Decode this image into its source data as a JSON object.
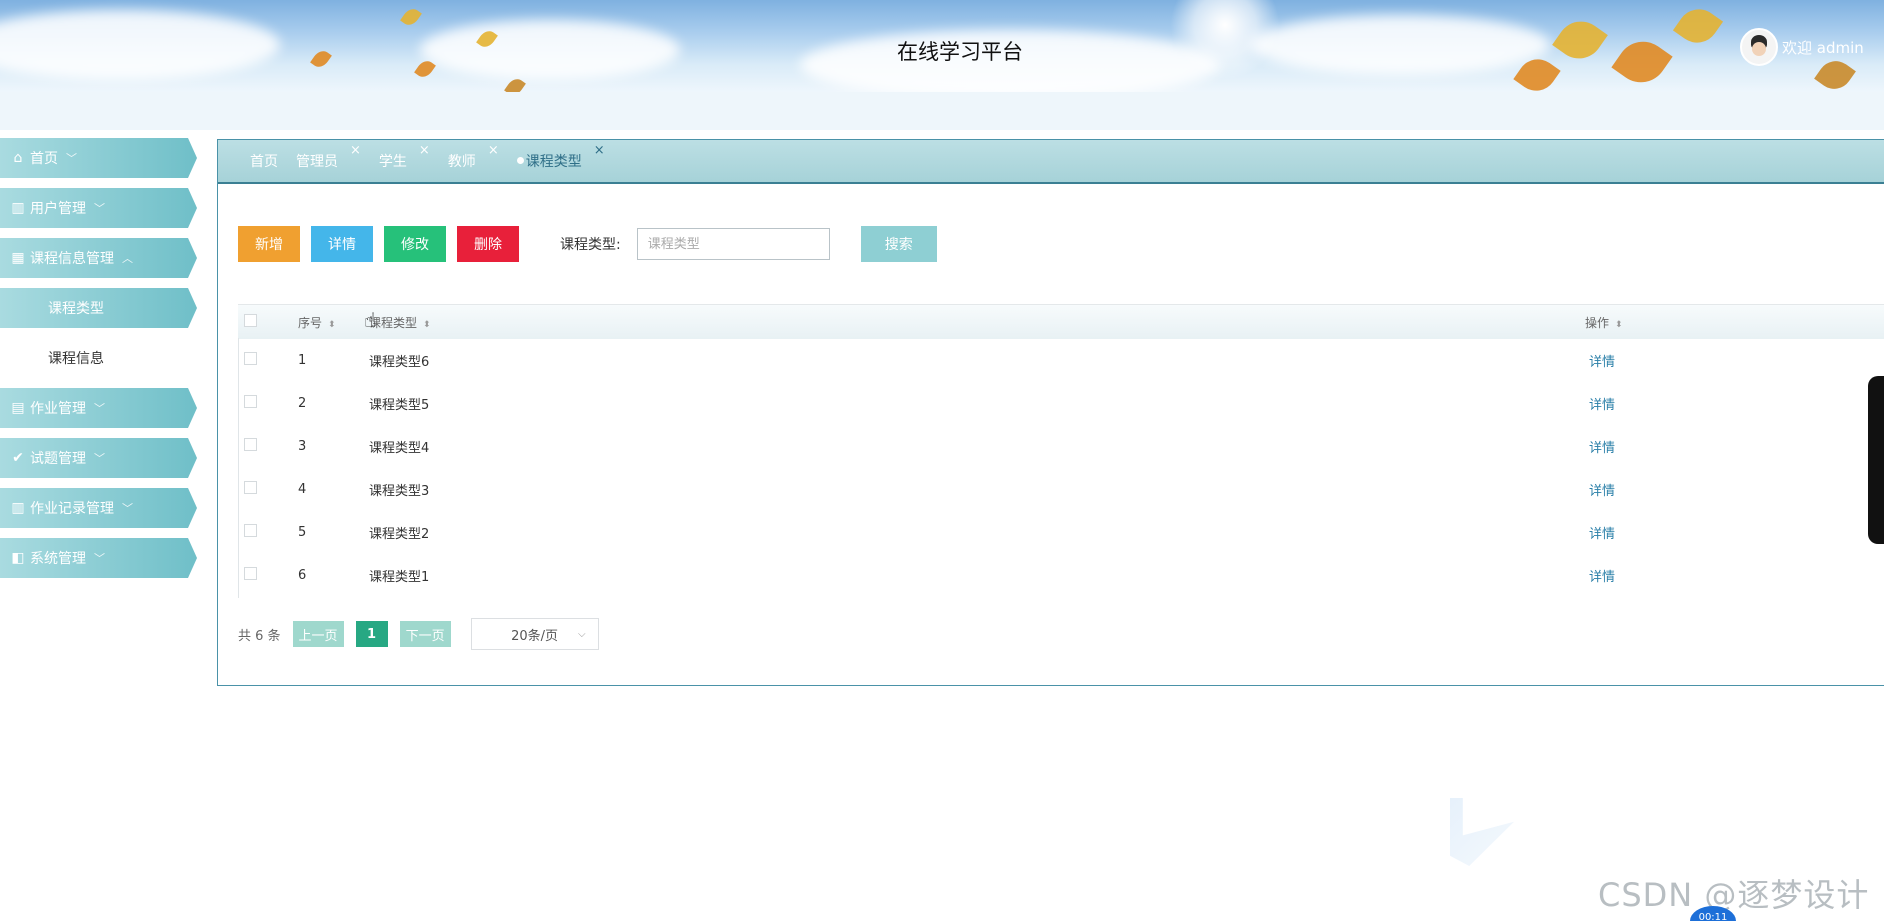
{
  "header": {
    "title": "在线学习平台",
    "welcome": "欢迎 admin"
  },
  "sidebar": {
    "items": [
      {
        "label": "首页",
        "icon": "home-icon",
        "glyph": "⌂",
        "chevron": "﹀"
      },
      {
        "label": "用户管理",
        "icon": "users-icon",
        "glyph": "▥",
        "chevron": "﹀"
      },
      {
        "label": "课程信息管理",
        "icon": "grid-icon",
        "glyph": "▦",
        "chevron": "︿",
        "children": [
          {
            "label": "课程类型",
            "active": true
          },
          {
            "label": "课程信息",
            "active": false
          }
        ]
      },
      {
        "label": "作业管理",
        "icon": "copy-icon",
        "glyph": "▤",
        "chevron": "﹀"
      },
      {
        "label": "试题管理",
        "icon": "check-circle-icon",
        "glyph": "✔",
        "chevron": "﹀"
      },
      {
        "label": "作业记录管理",
        "icon": "book-icon",
        "glyph": "▥",
        "chevron": "﹀"
      },
      {
        "label": "系统管理",
        "icon": "settings-box-icon",
        "glyph": "◧",
        "chevron": "﹀"
      }
    ]
  },
  "tabs": [
    {
      "label": "首页",
      "closable": false
    },
    {
      "label": "管理员",
      "closable": true
    },
    {
      "label": "学生",
      "closable": true
    },
    {
      "label": "教师",
      "closable": true
    },
    {
      "label": "课程类型",
      "closable": true,
      "active": true
    }
  ],
  "close_glyph": "×",
  "toolbar": {
    "add": "新增",
    "detail": "详情",
    "edit": "修改",
    "delete": "删除",
    "search_label": "课程类型:",
    "search_placeholder": "课程类型",
    "search_button": "搜索"
  },
  "table": {
    "columns": {
      "no": "序号",
      "type": "课程类型",
      "op": "操作"
    },
    "sort_glyph": "⬍",
    "rows": [
      {
        "no": "1",
        "type": "课程类型6",
        "op": "详情"
      },
      {
        "no": "2",
        "type": "课程类型5",
        "op": "详情"
      },
      {
        "no": "3",
        "type": "课程类型4",
        "op": "详情"
      },
      {
        "no": "4",
        "type": "课程类型3",
        "op": "详情"
      },
      {
        "no": "5",
        "type": "课程类型2",
        "op": "详情"
      },
      {
        "no": "6",
        "type": "课程类型1",
        "op": "详情"
      }
    ]
  },
  "pager": {
    "total": "共 6 条",
    "prev": "上一页",
    "current": "1",
    "next": "下一页",
    "page_size": "20条/页",
    "page_size_arrow": "⌵"
  },
  "overlay": {
    "watermark": "CSDN @逐梦设计",
    "timer": "00:11"
  },
  "colors": {
    "accent": "#6fbfc8",
    "add": "#f0a030",
    "detail": "#44b6ea",
    "edit": "#26c17a",
    "delete": "#e8203a",
    "search": "#8ecfd3",
    "pager_current": "#27a883"
  }
}
